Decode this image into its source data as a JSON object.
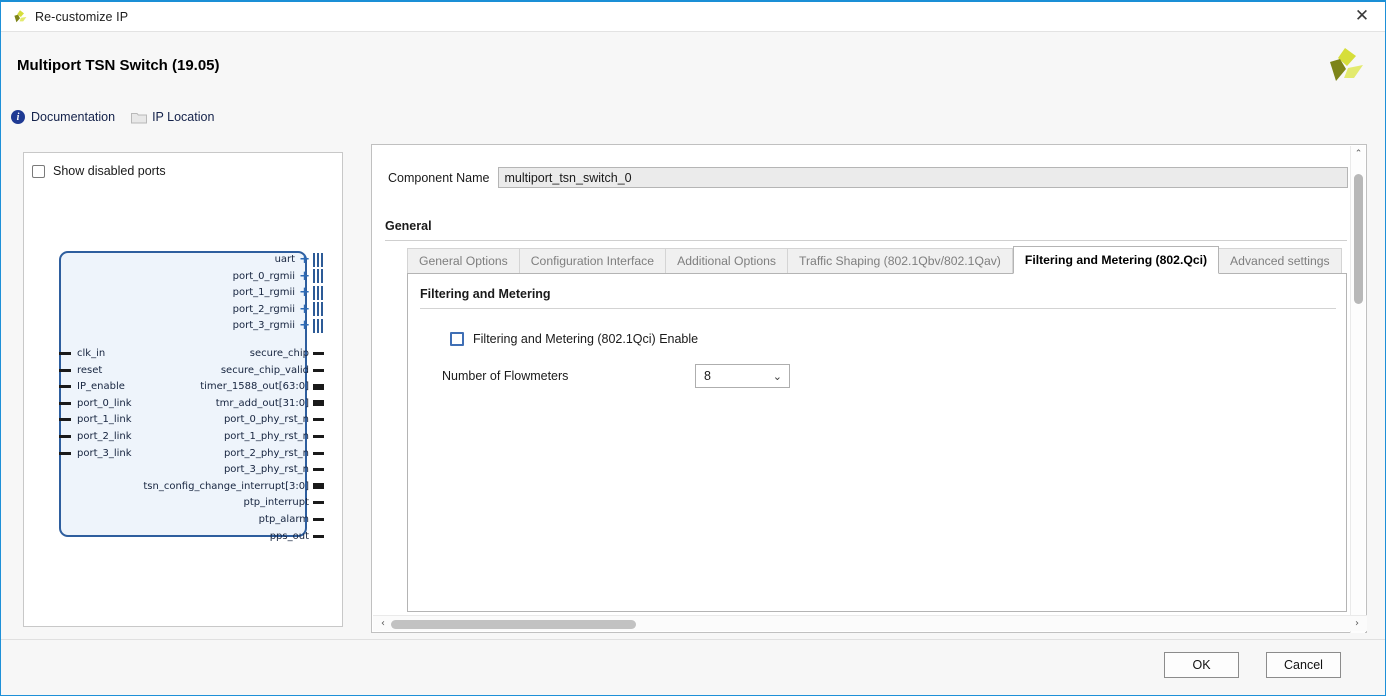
{
  "window": {
    "title": "Re-customize IP",
    "close_label": "✕",
    "logo_name": "xilinx-logo"
  },
  "header": {
    "page_title": "Multiport TSN Switch (19.05)",
    "links": [
      {
        "label": "Documentation",
        "icon": "info-icon"
      },
      {
        "label": "IP Location",
        "icon": "folder-icon"
      }
    ]
  },
  "left_panel": {
    "show_disabled_ports": {
      "label": "Show disabled ports",
      "checked": false
    },
    "diagram": {
      "bus_outputs": [
        {
          "label": "uart"
        },
        {
          "label": "port_0_rgmii"
        },
        {
          "label": "port_1_rgmii"
        },
        {
          "label": "port_2_rgmii"
        },
        {
          "label": "port_3_rgmii"
        }
      ],
      "inputs": [
        {
          "label": "clk_in"
        },
        {
          "label": "reset"
        },
        {
          "label": "IP_enable"
        },
        {
          "label": "port_0_link"
        },
        {
          "label": "port_1_link"
        },
        {
          "label": "port_2_link"
        },
        {
          "label": "port_3_link"
        }
      ],
      "outputs": [
        {
          "label": "secure_chip",
          "bus": false
        },
        {
          "label": "secure_chip_valid",
          "bus": false
        },
        {
          "label": "timer_1588_out[63:0]",
          "bus": true
        },
        {
          "label": "tmr_add_out[31:0]",
          "bus": true
        },
        {
          "label": "port_0_phy_rst_n",
          "bus": false
        },
        {
          "label": "port_1_phy_rst_n",
          "bus": false
        },
        {
          "label": "port_2_phy_rst_n",
          "bus": false
        },
        {
          "label": "port_3_phy_rst_n",
          "bus": false
        },
        {
          "label": "tsn_config_change_interrupt[3:0]",
          "bus": true
        },
        {
          "label": "ptp_interrupt",
          "bus": false
        },
        {
          "label": "ptp_alarm",
          "bus": false
        },
        {
          "label": "pps_out",
          "bus": false
        }
      ]
    }
  },
  "right_panel": {
    "component_name_label": "Component Name",
    "component_name_value": "multiport_tsn_switch_0",
    "general_label": "General",
    "tabs": [
      {
        "label": "General Options",
        "active": false
      },
      {
        "label": "Configuration Interface",
        "active": false
      },
      {
        "label": "Additional Options",
        "active": false
      },
      {
        "label": "Traffic Shaping (802.1Qbv/802.1Qav)",
        "active": false
      },
      {
        "label": "Filtering and Metering (802.Qci)",
        "active": true
      },
      {
        "label": "Advanced settings",
        "active": false
      }
    ],
    "panel": {
      "section_title": "Filtering and Metering",
      "enable_checkbox": {
        "label": "Filtering and Metering (802.1Qci) Enable",
        "checked": false
      },
      "flowmeters": {
        "label": "Number of Flowmeters",
        "value": "8",
        "caret": "⌄"
      }
    },
    "scroll": {
      "up": "⌃",
      "down": "⌄",
      "left": "‹",
      "right": "›"
    }
  },
  "footer": {
    "ok_label": "OK",
    "cancel_label": "Cancel"
  },
  "colors": {
    "accent": "#1a8fd6",
    "block_border": "#2e5e9e",
    "block_fill": "#eef4fb",
    "link_text": "#14224a",
    "checkbox_blue": "#3f6fb5"
  }
}
